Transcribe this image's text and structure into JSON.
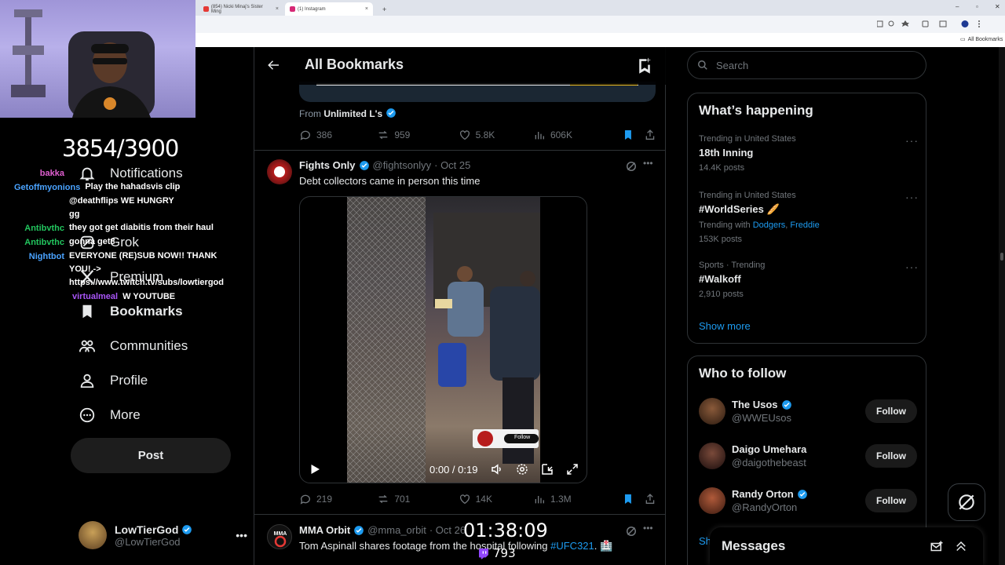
{
  "browser": {
    "tabs": [
      {
        "label": "(854) Nicki Minaj's Sister Ming",
        "close": "×"
      },
      {
        "label": "(1) Instagram",
        "close": "×"
      }
    ],
    "new_tab": "+",
    "bookmarks_bar": "All Bookmarks"
  },
  "stream": {
    "counter": "3854/3900",
    "timer": "01:38:09",
    "viewers": "793",
    "chat": [
      {
        "user": "bakka",
        "user_color": "#e05fd0",
        "msg": ""
      },
      {
        "user": "Getoffmyonions",
        "user_color": "#4aa3ff",
        "msg": "Play the hahadsvis clip"
      },
      {
        "user": "",
        "user_color": "#ffffff",
        "msg": "@deathflips WE HUNGRY"
      },
      {
        "user": "",
        "user_color": "#ffffff",
        "msg": "gg"
      },
      {
        "user": "Antibvthc",
        "user_color": "#22c55e",
        "msg": "they got get diabitis from their haul"
      },
      {
        "user": "Antibvthc",
        "user_color": "#22c55e",
        "msg": "gonna get8"
      },
      {
        "user": "Nightbot",
        "user_color": "#4aa3ff",
        "msg": "EVERYONE (RE)SUB NOW!! THANK YOU! -> https://www.twitch.tv/subs/lowtiergod"
      },
      {
        "user": "virtualmeal",
        "user_color": "#a855f7",
        "msg": "W YOUTUBE"
      }
    ]
  },
  "sidebar": {
    "items": [
      {
        "label": "Notifications"
      },
      {
        "label": "Grok"
      },
      {
        "label": "Premium"
      },
      {
        "label": "Bookmarks"
      },
      {
        "label": "Communities"
      },
      {
        "label": "Profile"
      },
      {
        "label": "More"
      }
    ],
    "post_label": "Post",
    "account": {
      "name": "LowTierGod",
      "handle": "@LowTierGod"
    }
  },
  "main": {
    "title": "All Bookmarks",
    "prev_tweet": {
      "from_prefix": "From",
      "from_name": "Unlimited L's",
      "replies": "386",
      "reposts": "959",
      "likes": "5.8K",
      "views": "606K"
    },
    "tweets": [
      {
        "name": "Fights Only",
        "handle": "@fightsonlyy",
        "date": "· Oct 25",
        "text": "Debt collectors came in person this time",
        "video_time": "0:00 / 0:19",
        "video_follow": "Follow",
        "replies": "219",
        "reposts": "701",
        "likes": "14K",
        "views": "1.3M"
      },
      {
        "name": "MMA Orbit",
        "handle": "@mma_orbit",
        "date": "· Oct 26",
        "text": "Tom Aspinall shares footage from the hospital following ",
        "hashtag": "#UFC321",
        "text_end": ". 🏥"
      }
    ]
  },
  "right": {
    "search_placeholder": "Search",
    "happening_title": "What’s happening",
    "trends": [
      {
        "meta": "Trending in United States",
        "name": "18th Inning",
        "count": "14.4K posts"
      },
      {
        "meta": "Trending in United States",
        "name": "#WorldSeries 🥖",
        "with_prefix": "Trending with",
        "with_1": "Dodgers",
        "with_sep": ",",
        "with_2": "Freddie",
        "count": "153K posts"
      },
      {
        "meta": "Sports · Trending",
        "name": "#Walkoff",
        "count": "2,910 posts"
      }
    ],
    "show_more": "Show more",
    "wtf_title": "Who to follow",
    "who_to_follow": [
      {
        "name": "The Usos",
        "handle": "@WWEUsos",
        "verified": true,
        "follow": "Follow"
      },
      {
        "name": "Daigo Umehara",
        "handle": "@daigothebeast",
        "verified": false,
        "follow": "Follow"
      },
      {
        "name": "Randy Orton",
        "handle": "@RandyOrton",
        "verified": true,
        "follow": "Follow"
      }
    ],
    "wtf_show_more": "Sh",
    "messages_title": "Messages"
  },
  "colors": {
    "accent": "#1d9bf0",
    "border": "#2f3336",
    "muted": "#71767b"
  }
}
